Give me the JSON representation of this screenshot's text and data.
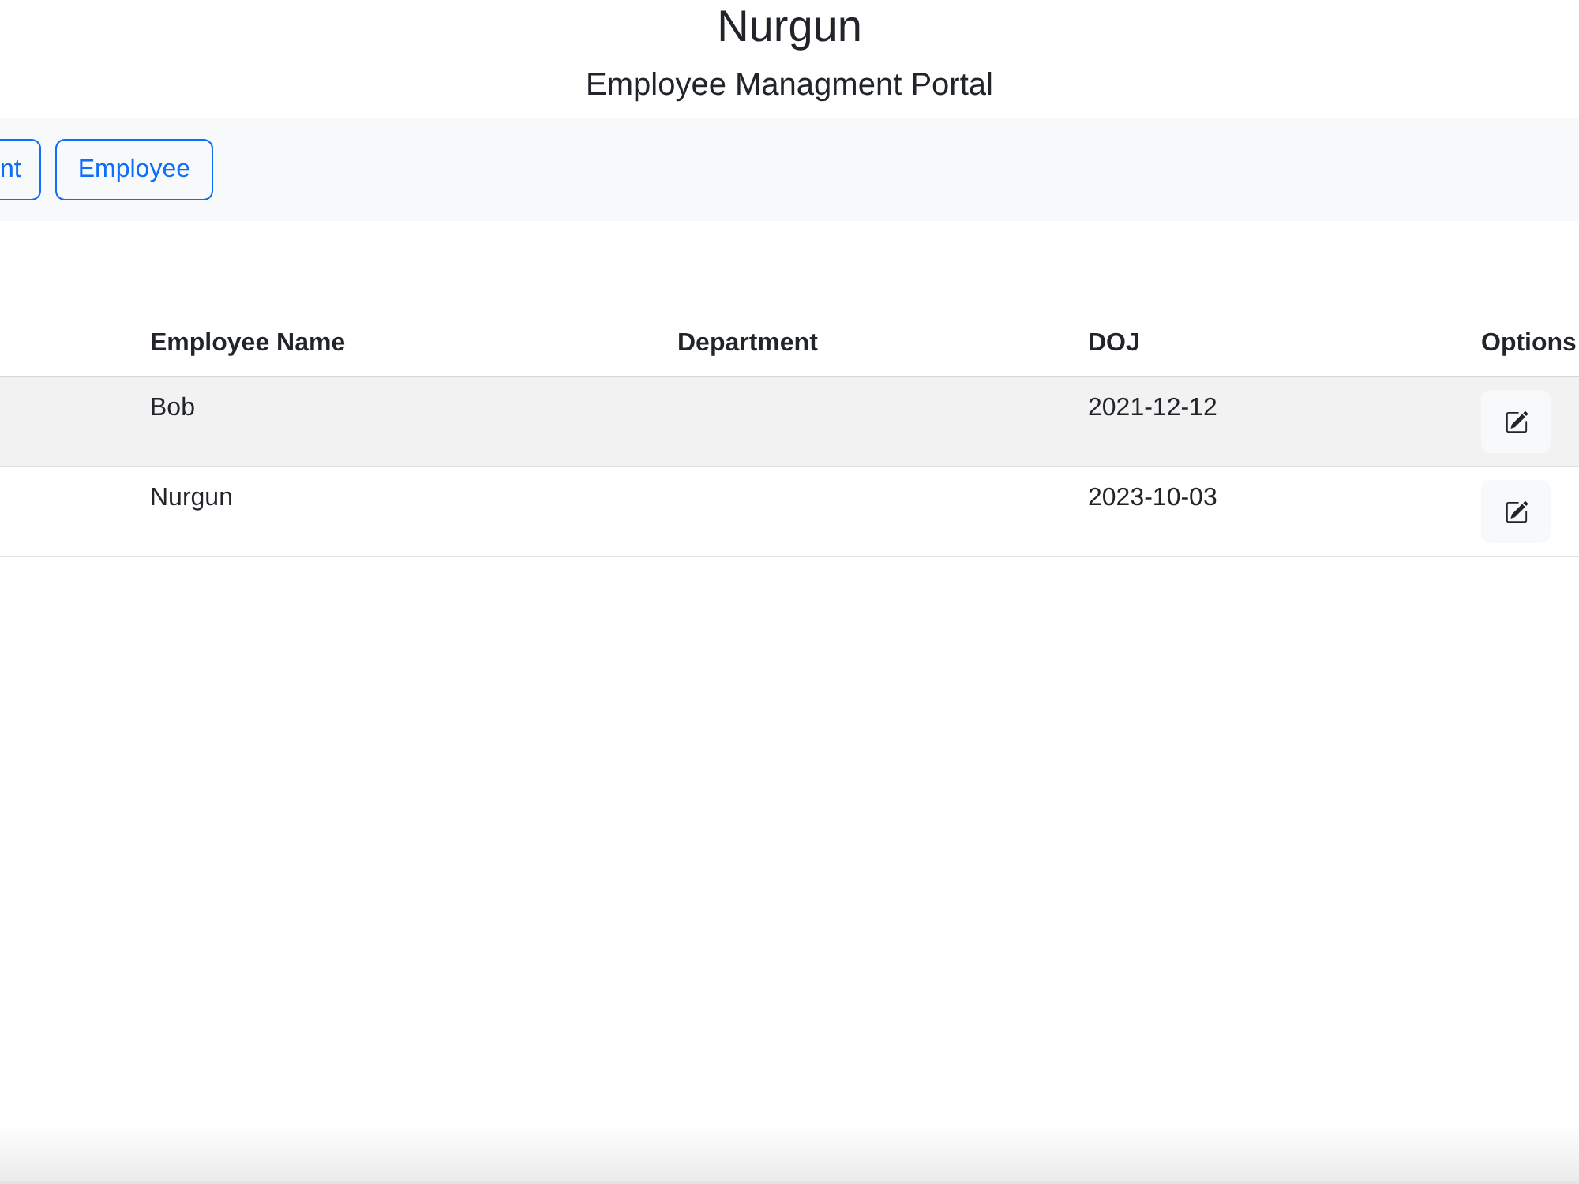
{
  "header": {
    "title": "Nurgun",
    "subtitle": "Employee Managment Portal"
  },
  "nav": {
    "buttons": [
      {
        "label": "nt"
      },
      {
        "label": "Employee"
      }
    ]
  },
  "table": {
    "columns": [
      "Employee Name",
      "Department",
      "DOJ",
      "Options"
    ],
    "rows": [
      {
        "employee_name": "Bob",
        "doj": "2021-12-12"
      },
      {
        "employee_name": "Nurgun",
        "doj": "2023-10-03"
      }
    ]
  }
}
